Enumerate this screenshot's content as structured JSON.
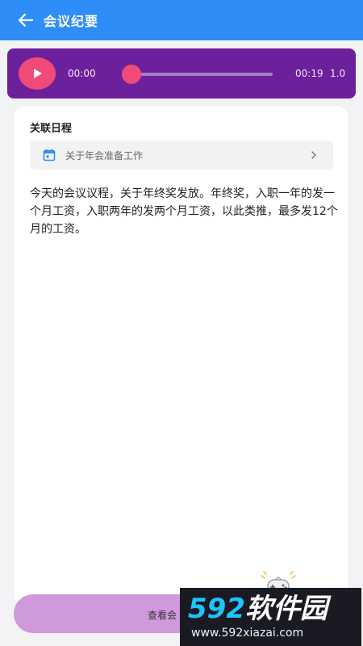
{
  "header": {
    "title": "会议纪要",
    "back_icon": "arrow-left-icon"
  },
  "player": {
    "current_time": "00:00",
    "total_time": "00:19",
    "speed": "1.0",
    "progress": 0,
    "accent_color": "#ef4a78",
    "background_color": "#6d209c"
  },
  "schedule": {
    "label": "关联日程",
    "linked_item": "关于年会准备工作",
    "icon": "calendar-icon"
  },
  "note": {
    "text": "今天的会议议程，关于年终奖发放。年终奖，入职一年的发一个月工资，入职两年的发两个月工资，以此类推，最多发12个月的工资。"
  },
  "bottom_button": {
    "label": "查看会"
  },
  "watermark": {
    "brand_number": "592",
    "brand_name": "软件园",
    "url": "www.592xiazai.com"
  },
  "colors": {
    "app_bar": "#2f8df7",
    "bottom_button": "#cf99dc"
  }
}
